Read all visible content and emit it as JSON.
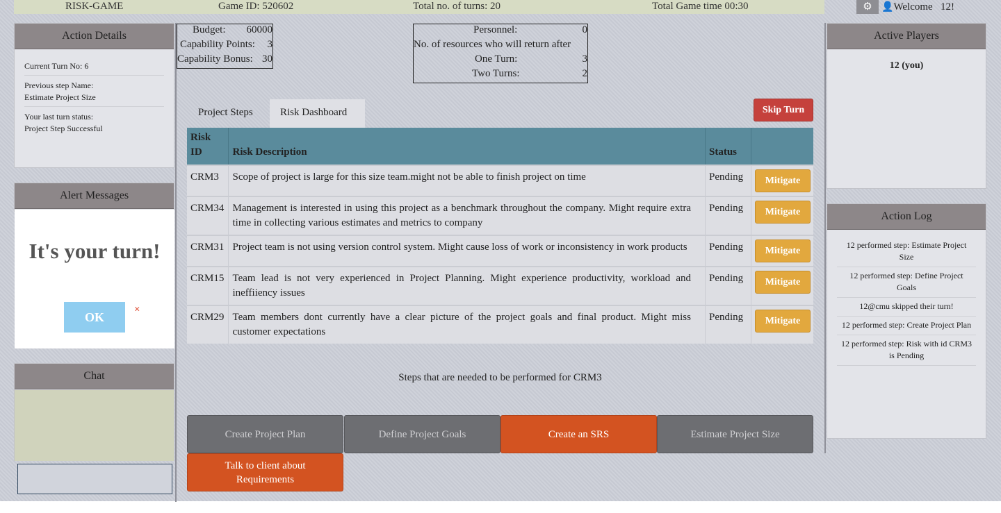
{
  "topbar": {
    "app_name": "RISK-GAME",
    "game_id": "Game ID: 520602",
    "turns": "Total no. of turns:  20",
    "time": "Total Game time 00:30",
    "gear_icon": "gear",
    "welcome": "Welcome",
    "user": "12!"
  },
  "action_details": {
    "title": "Action Details",
    "current_turn": "Current  Turn No: 6",
    "previous_step_label": "Previous  step Name:",
    "previous_step_value": "Estimate  Project Size",
    "last_status_label": "Your last turn  status:",
    "last_status_value": "Project Step Successful"
  },
  "alert_messages": {
    "title": "Alert Messages"
  },
  "modal": {
    "title": "It's your turn!",
    "ok": "OK",
    "close": "×"
  },
  "chat": {
    "title": "Chat",
    "input_value": ""
  },
  "budget_box": {
    "budget_label": "Budget:",
    "budget_value": "60000",
    "cap_points_label": "Capability  Points:",
    "cap_points_value": "3",
    "cap_bonus_label": "Capability  Bonus:",
    "cap_bonus_value": "30"
  },
  "personnel_box": {
    "personnel_label": "Personnel:",
    "personnel_value": "0",
    "resources_label": "No. of resources  who will return  after",
    "one_turn_label": "One Turn:",
    "one_turn_value": "3",
    "two_turns_label": "Two Turns:",
    "two_turns_value": "2"
  },
  "tabs": [
    {
      "label": "Project Steps",
      "active": false
    },
    {
      "label": "Risk Dashboard",
      "active": true
    }
  ],
  "skip_turn": "Skip Turn",
  "risk_table": {
    "headers": [
      "Risk ID",
      "Risk Description",
      "Status",
      ""
    ],
    "rows": [
      {
        "id": "CRM3",
        "description": "Scope of project is large for this size team.might  not be able to finish project on time",
        "status": "Pending",
        "action": "Mitigate"
      },
      {
        "id": "CRM34",
        "description": "Management  is interested  in using  this project as a benchmark  throughout  the company. Might require  extra time  in collecting  various  estimates  and  metrics  to company",
        "status": "Pending",
        "action": "Mitigate"
      },
      {
        "id": "CRM31",
        "description": "Project team is not using version  control  system. Might cause loss of work  or inconsistency  in work products",
        "status": "Pending",
        "action": "Mitigate"
      },
      {
        "id": "CRM15",
        "description": "Team lead is not very experienced  in Project Planning. Might experience productivity,  workload  and ineffiiency  issues",
        "status": "Pending",
        "action": "Mitigate"
      },
      {
        "id": "CRM29",
        "description": "Team members  dont currently  have  a clear picture  of the project goals and final product. Might miss customer  expectations",
        "status": "Pending",
        "action": "Mitigate"
      }
    ]
  },
  "steps_caption": "Steps that  are needed  to be performed   for CRM3",
  "step_buttons": [
    "Create  Project Plan",
    "Define  Project Goals",
    "Create  an SRS",
    "Estimate  Project Size",
    "Talk to client about Requirements"
  ],
  "active_players": {
    "title": "Active Players",
    "players": [
      "12 (you)"
    ]
  },
  "action_log": {
    "title": "Action Log",
    "entries": [
      "12 performed   step: Estimate  Project Size",
      "12 performed   step: Define Project Goals",
      "12@cmu skipped  their turn!",
      "12 performed   step: Create Project Plan",
      "12 performed   step: Risk with  id CRM3 is Pending"
    ]
  },
  "colors": {
    "header_gray": "#8d8789",
    "table_header": "#5a8b9c",
    "skip_red": "#c5413c",
    "mitigate_orange": "#e2a83e",
    "active_step": "#d35321",
    "ok_blue": "#8fcdf0"
  }
}
